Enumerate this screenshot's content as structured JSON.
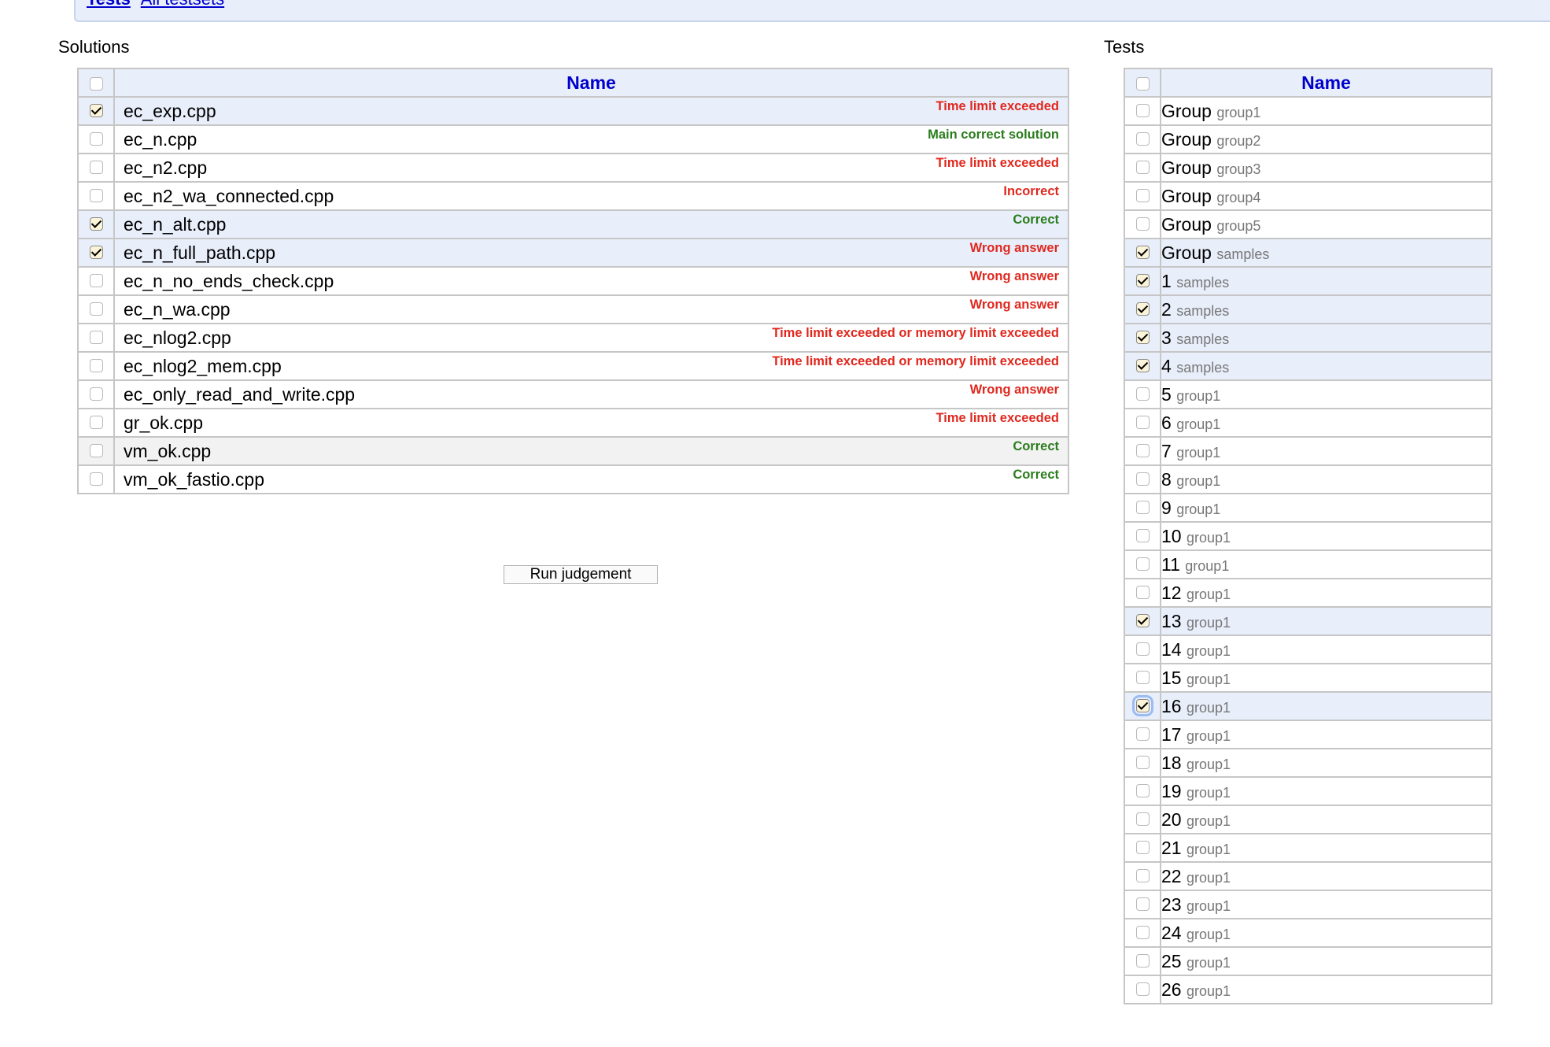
{
  "top_links": [
    "Tests",
    "All testsets"
  ],
  "solutions": {
    "title": "Solutions",
    "header": "Name",
    "rows": [
      {
        "file": "ec_exp.cpp",
        "verdict": "Time limit exceeded",
        "color": "#e0281e",
        "checked": true
      },
      {
        "file": "ec_n.cpp",
        "verdict": "Main correct solution",
        "color": "#2a7d1c",
        "checked": false
      },
      {
        "file": "ec_n2.cpp",
        "verdict": "Time limit exceeded",
        "color": "#e0281e",
        "checked": false
      },
      {
        "file": "ec_n2_wa_connected.cpp",
        "verdict": "Incorrect",
        "color": "#e0281e",
        "checked": false
      },
      {
        "file": "ec_n_alt.cpp",
        "verdict": "Correct",
        "color": "#2a7d1c",
        "checked": true
      },
      {
        "file": "ec_n_full_path.cpp",
        "verdict": "Wrong answer",
        "color": "#e0281e",
        "checked": true
      },
      {
        "file": "ec_n_no_ends_check.cpp",
        "verdict": "Wrong answer",
        "color": "#e0281e",
        "checked": false
      },
      {
        "file": "ec_n_wa.cpp",
        "verdict": "Wrong answer",
        "color": "#e0281e",
        "checked": false
      },
      {
        "file": "ec_nlog2.cpp",
        "verdict": "Time limit exceeded or memory limit exceeded",
        "color": "#e0281e",
        "checked": false
      },
      {
        "file": "ec_nlog2_mem.cpp",
        "verdict": "Time limit exceeded or memory limit exceeded",
        "color": "#e0281e",
        "checked": false
      },
      {
        "file": "ec_only_read_and_write.cpp",
        "verdict": "Wrong answer",
        "color": "#e0281e",
        "checked": false
      },
      {
        "file": "gr_ok.cpp",
        "verdict": "Time limit exceeded",
        "color": "#e0281e",
        "checked": false
      },
      {
        "file": "vm_ok.cpp",
        "verdict": "Correct",
        "color": "#2a7d1c",
        "checked": false
      },
      {
        "file": "vm_ok_fastio.cpp",
        "verdict": "Correct",
        "color": "#2a7d1c",
        "checked": false
      }
    ]
  },
  "run_button": "Run judgement",
  "tests": {
    "title": "Tests",
    "header": "Name",
    "rows": [
      {
        "name": "Group",
        "group": "group1",
        "checked": false
      },
      {
        "name": "Group",
        "group": "group2",
        "checked": false
      },
      {
        "name": "Group",
        "group": "group3",
        "checked": false
      },
      {
        "name": "Group",
        "group": "group4",
        "checked": false
      },
      {
        "name": "Group",
        "group": "group5",
        "checked": false
      },
      {
        "name": "Group",
        "group": "samples",
        "checked": true
      },
      {
        "name": "1",
        "group": "samples",
        "checked": true
      },
      {
        "name": "2",
        "group": "samples",
        "checked": true
      },
      {
        "name": "3",
        "group": "samples",
        "checked": true
      },
      {
        "name": "4",
        "group": "samples",
        "checked": true
      },
      {
        "name": "5",
        "group": "group1",
        "checked": false
      },
      {
        "name": "6",
        "group": "group1",
        "checked": false
      },
      {
        "name": "7",
        "group": "group1",
        "checked": false
      },
      {
        "name": "8",
        "group": "group1",
        "checked": false
      },
      {
        "name": "9",
        "group": "group1",
        "checked": false
      },
      {
        "name": "10",
        "group": "group1",
        "checked": false
      },
      {
        "name": "11",
        "group": "group1",
        "checked": false
      },
      {
        "name": "12",
        "group": "group1",
        "checked": false
      },
      {
        "name": "13",
        "group": "group1",
        "checked": true
      },
      {
        "name": "14",
        "group": "group1",
        "checked": false
      },
      {
        "name": "15",
        "group": "group1",
        "checked": false
      },
      {
        "name": "16",
        "group": "group1",
        "checked": true
      },
      {
        "name": "17",
        "group": "group1",
        "checked": false
      },
      {
        "name": "18",
        "group": "group1",
        "checked": false
      },
      {
        "name": "19",
        "group": "group1",
        "checked": false
      },
      {
        "name": "20",
        "group": "group1",
        "checked": false
      },
      {
        "name": "21",
        "group": "group1",
        "checked": false
      },
      {
        "name": "22",
        "group": "group1",
        "checked": false
      },
      {
        "name": "23",
        "group": "group1",
        "checked": false
      },
      {
        "name": "24",
        "group": "group1",
        "checked": false
      },
      {
        "name": "25",
        "group": "group1",
        "checked": false
      },
      {
        "name": "26",
        "group": "group1",
        "checked": false
      }
    ]
  }
}
